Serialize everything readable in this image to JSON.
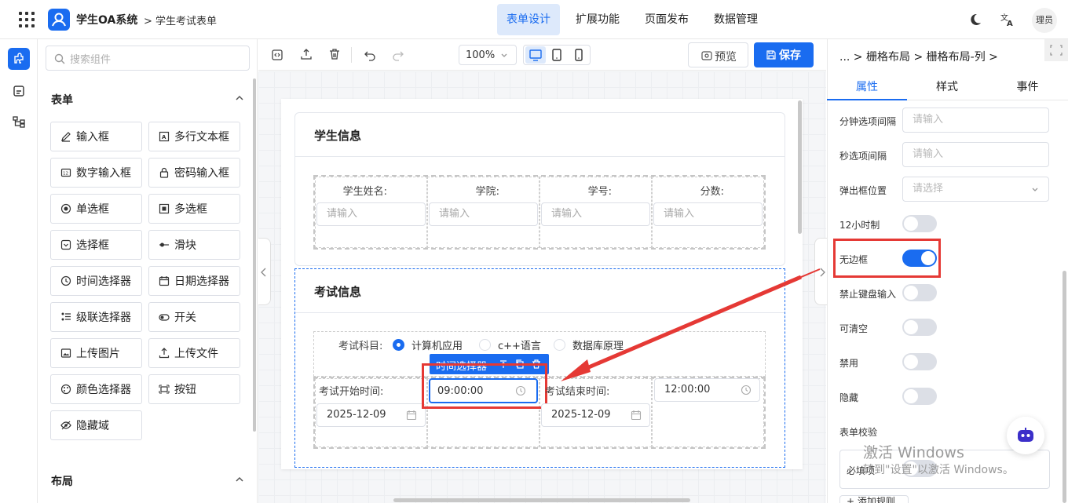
{
  "header": {
    "app_name": "学生OA系统",
    "breadcrumb": "> 学生考试表单",
    "nav": [
      "表单设计",
      "扩展功能",
      "页面发布",
      "数据管理"
    ],
    "active_nav": "表单设计",
    "user": "理员"
  },
  "left": {
    "search_placeholder": "搜索组件",
    "form_section": "表单",
    "layout_section": "布局",
    "components": [
      {
        "label": "输入框",
        "icon": "pencil-icon"
      },
      {
        "label": "多行文本框",
        "icon": "textarea-icon"
      },
      {
        "label": "数字输入框",
        "icon": "number-icon"
      },
      {
        "label": "密码输入框",
        "icon": "lock-icon"
      },
      {
        "label": "单选框",
        "icon": "radio-icon"
      },
      {
        "label": "多选框",
        "icon": "checkbox-icon"
      },
      {
        "label": "选择框",
        "icon": "select-icon"
      },
      {
        "label": "滑块",
        "icon": "slider-icon"
      },
      {
        "label": "时间选择器",
        "icon": "clock-icon"
      },
      {
        "label": "日期选择器",
        "icon": "calendar-icon"
      },
      {
        "label": "级联选择器",
        "icon": "cascader-icon"
      },
      {
        "label": "开关",
        "icon": "switch-icon"
      },
      {
        "label": "上传图片",
        "icon": "image-icon"
      },
      {
        "label": "上传文件",
        "icon": "upload-icon"
      },
      {
        "label": "颜色选择器",
        "icon": "palette-icon"
      },
      {
        "label": "按钮",
        "icon": "button-icon"
      },
      {
        "label": "隐藏域",
        "icon": "eye-off-icon"
      }
    ]
  },
  "toolbar": {
    "zoom": "100%",
    "preview": "预览",
    "save": "保存"
  },
  "form": {
    "section1_title": "学生信息",
    "section1_fields": [
      "学生姓名:",
      "学院:",
      "学号:",
      "分数:"
    ],
    "placeholder": "请输入",
    "section2_title": "考试信息",
    "subject_label": "考试科目:",
    "subject_options": [
      "计算机应用",
      "c++语言",
      "数据库原理"
    ],
    "selected_subject": "计算机应用",
    "selected_tag": "时间选择器",
    "start_label": "考试开始时间:",
    "start_time": "09:00:00",
    "start_date": "2025-12-09",
    "end_label": "考试结束时间:",
    "end_time": "12:00:00",
    "end_date": "2025-12-09"
  },
  "right": {
    "breadcrumb": [
      "...",
      "栅格布局",
      "栅格布局-列"
    ],
    "tabs": [
      "属性",
      "样式",
      "事件"
    ],
    "active_tab": "属性",
    "minute_step_label": "分钟选项间隔",
    "second_step_label": "秒选项间隔",
    "popup_position_label": "弹出框位置",
    "input_placeholder": "请输入",
    "select_placeholder": "请选择",
    "switches": [
      {
        "label": "12小时制",
        "on": false
      },
      {
        "label": "无边框",
        "on": true
      },
      {
        "label": "禁止键盘输入",
        "on": false
      },
      {
        "label": "可清空",
        "on": false
      },
      {
        "label": "禁用",
        "on": false
      },
      {
        "label": "隐藏",
        "on": false
      }
    ],
    "validation_label": "表单校验",
    "required_label": "必填项",
    "add_rule": "+ 添加规则"
  },
  "watermark": {
    "line1": "激活 Windows",
    "line2": "转到\"设置\"以激活 Windows。"
  },
  "colors": {
    "primary": "#1a6cf0",
    "highlight": "#e53935"
  }
}
